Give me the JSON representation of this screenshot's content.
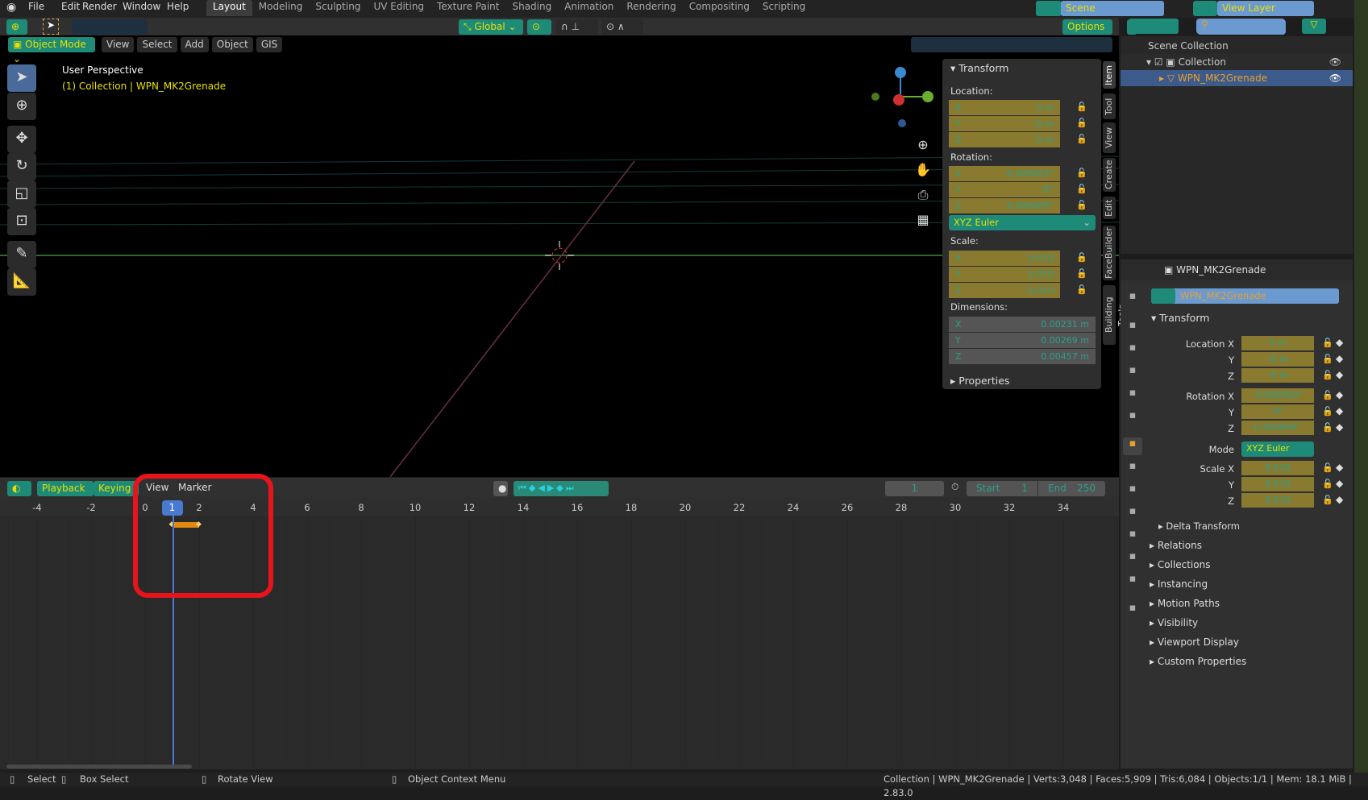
{
  "menu": {
    "items": [
      "File",
      "Edit",
      "Render",
      "Window",
      "Help"
    ]
  },
  "workspaces": [
    "Layout",
    "Modeling",
    "Sculpting",
    "UV Editing",
    "Texture Paint",
    "Shading",
    "Animation",
    "Rendering",
    "Compositing",
    "Scripting"
  ],
  "scene": {
    "scene_name": "Scene",
    "view_layer": "View Layer"
  },
  "header": {
    "orientation": "Global",
    "options": "Options",
    "mode": "Object Mode",
    "menus": [
      "View",
      "Select",
      "Add",
      "Object",
      "GIS"
    ]
  },
  "viewport": {
    "title": "User Perspective",
    "subtitle": "(1) Collection | WPN_MK2Grenade"
  },
  "npanel": {
    "tabs": [
      "Item",
      "Tool",
      "View",
      "Create",
      "Edit",
      "FaceBuilder",
      "Building Tools"
    ],
    "transform": "Transform",
    "location_label": "Location:",
    "location": [
      "0 m",
      "-0 m",
      "-0 m"
    ],
    "rotation_label": "Rotation:",
    "rotation": [
      "-0.000003°",
      "-0°",
      "0.000009°"
    ],
    "rotation_mode": "XYZ Euler",
    "scale_label": "Scale:",
    "scale": [
      "0.010",
      "0.010",
      "0.010"
    ],
    "dimensions_label": "Dimensions:",
    "dimensions": [
      "0.00231 m",
      "0.00269 m",
      "0.00457 m"
    ],
    "axes": [
      "X",
      "Y",
      "Z"
    ],
    "properties": "Properties"
  },
  "outliner": {
    "scene_collection": "Scene Collection",
    "collection": "Collection",
    "object": "WPN_MK2Grenade"
  },
  "properties": {
    "object_name": "WPN_MK2Grenade",
    "data_name": "WPN_MK2Grenade",
    "transform": "Transform",
    "location_label": "Location X",
    "rotation_label": "Rotation X",
    "mode_label": "Mode",
    "scale_label": "Scale X",
    "y": "Y",
    "z": "Z",
    "delta": "Delta Transform",
    "sections": [
      "Relations",
      "Collections",
      "Instancing",
      "Motion Paths",
      "Visibility",
      "Viewport Display",
      "Custom Properties"
    ]
  },
  "timeline": {
    "playback": "Playback",
    "keying": "Keying",
    "view": "View",
    "marker": "Marker",
    "current_frame": "1",
    "start_label": "Start",
    "start": "1",
    "end_label": "End",
    "end": "250",
    "ruler": [
      -4,
      -2,
      0,
      2,
      4,
      6,
      8,
      10,
      12,
      14,
      16,
      18,
      20,
      22,
      24,
      26,
      28,
      30,
      32,
      34
    ],
    "keyframes": [
      1,
      2
    ],
    "highlight_color": "#e8141c"
  },
  "status": {
    "select": "Select",
    "box_select": "Box Select",
    "rotate_view": "Rotate View",
    "context_menu": "Object Context Menu",
    "info": "Collection | WPN_MK2Grenade | Verts:3,048 | Faces:5,909 | Tris:6,084 | Objects:1/1 | Mem: 18.1 MiB | 2.83.0"
  }
}
